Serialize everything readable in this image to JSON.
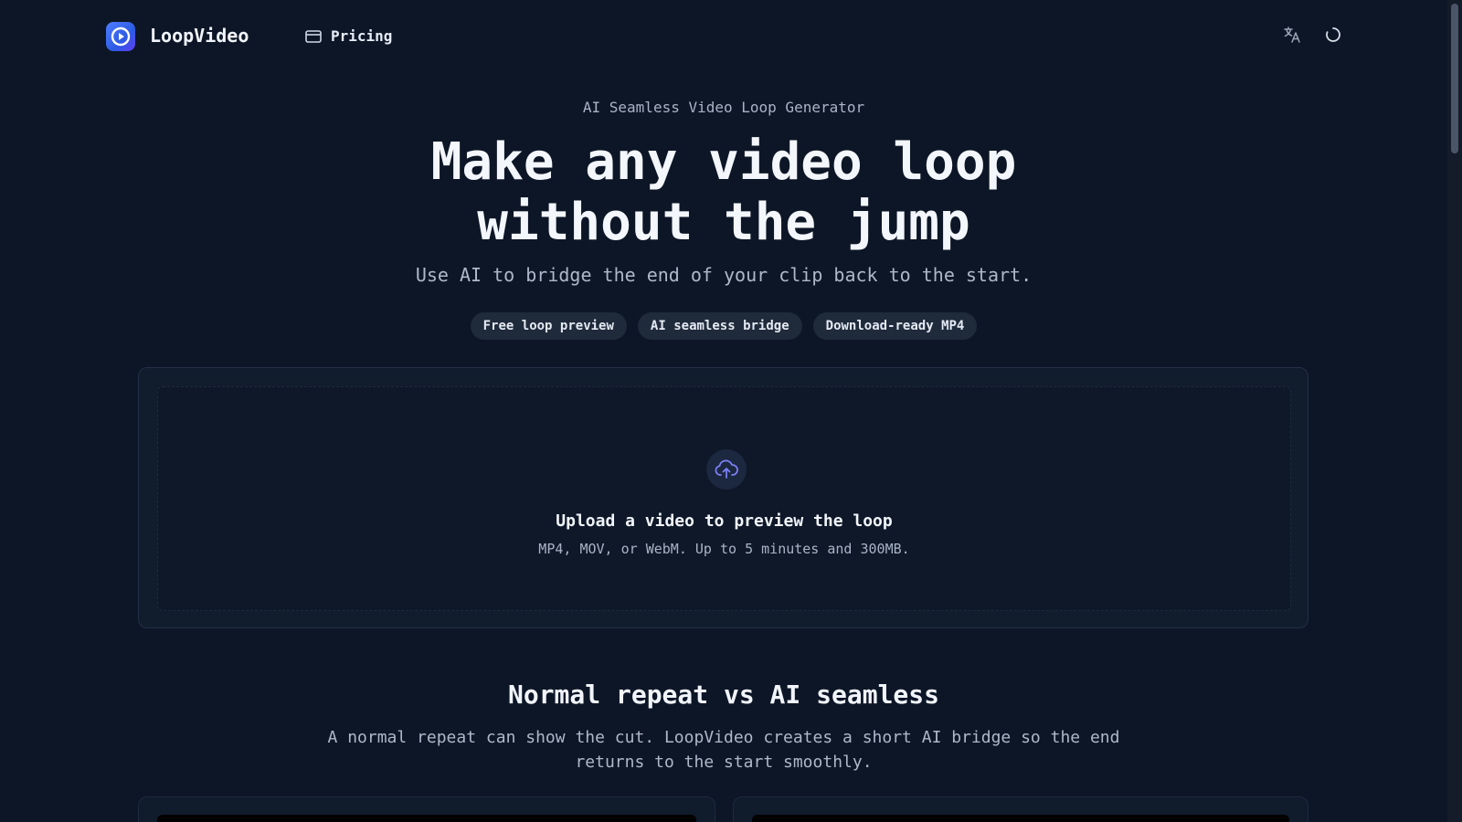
{
  "header": {
    "brand": "LoopVideo",
    "nav": {
      "pricing_label": "Pricing"
    }
  },
  "hero": {
    "eyebrow": "AI Seamless Video Loop Generator",
    "title_line1": "Make any video loop",
    "title_line2": "without the jump",
    "subtitle": "Use AI to bridge the end of your clip back to the start.",
    "chips": [
      "Free loop preview",
      "AI seamless bridge",
      "Download-ready MP4"
    ]
  },
  "upload": {
    "title": "Upload a video to preview the loop",
    "hint": "MP4, MOV, or WebM. Up to 5 minutes and 300MB."
  },
  "comparison": {
    "title": "Normal repeat vs AI seamless",
    "subtitle_line1": "A normal repeat can show the cut. LoopVideo creates a short AI bridge so the end",
    "subtitle_line2": "returns to the start smoothly."
  },
  "icons": {
    "logo": "play-loop-logo-icon",
    "pricing": "credit-card-icon",
    "translate": "translate-icon",
    "loading": "loading-spinner-icon",
    "upload": "cloud-upload-icon"
  },
  "colors": {
    "background": "#0d1626",
    "accent": "#3b6cf6",
    "upload_icon": "#7b7ff6",
    "chip_bg": "#1f2a3b"
  }
}
